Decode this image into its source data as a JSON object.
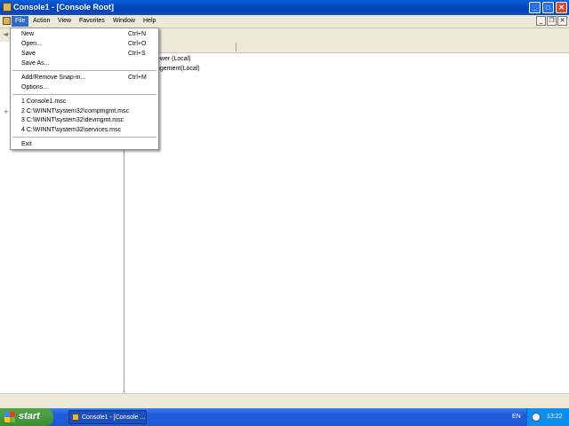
{
  "window": {
    "title": "Console1 - [Console Root]",
    "controls": {
      "minimize": "_",
      "maximize": "□",
      "close": "✕"
    }
  },
  "menubar": {
    "file_label": "File",
    "items": [
      "Action",
      "View",
      "Favorites",
      "Window",
      "Help"
    ],
    "mdi_controls": {
      "minimize": "_",
      "restore": "❐",
      "close": "✕"
    }
  },
  "toolbar": {
    "back": "◄"
  },
  "file_menu": {
    "group1": [
      {
        "label": "New",
        "shortcut": "Ctrl+N"
      },
      {
        "label": "Open...",
        "shortcut": "Ctrl+O"
      },
      {
        "label": "Save",
        "shortcut": "Ctrl+S"
      },
      {
        "label": "Save As...",
        "shortcut": ""
      }
    ],
    "group2": [
      {
        "label": "Add/Remove Snap-in...",
        "shortcut": "Ctrl+M"
      },
      {
        "label": "Options...",
        "shortcut": ""
      }
    ],
    "recent": [
      "1 Console1.msc",
      "2 C:\\WINNT\\system32\\compmgmt.msc",
      "3 C:\\WINNT\\system32\\devmgmt.msc",
      "4 C:\\WINNT\\system32\\services.msc"
    ],
    "exit": "Exit"
  },
  "right_pane": {
    "items": [
      "ewer (Local)",
      "agement(Local)"
    ]
  },
  "taskbar": {
    "start_label": "start",
    "task_button": "Console1 - [Console ...",
    "language": "EN",
    "clock": "13:22"
  },
  "colors": {
    "titlebar": "#0a5fd8",
    "menu_highlight": "#316ac5",
    "taskbar": "#245edb",
    "start_button": "#3c8d35",
    "tray": "#0f8ded"
  }
}
